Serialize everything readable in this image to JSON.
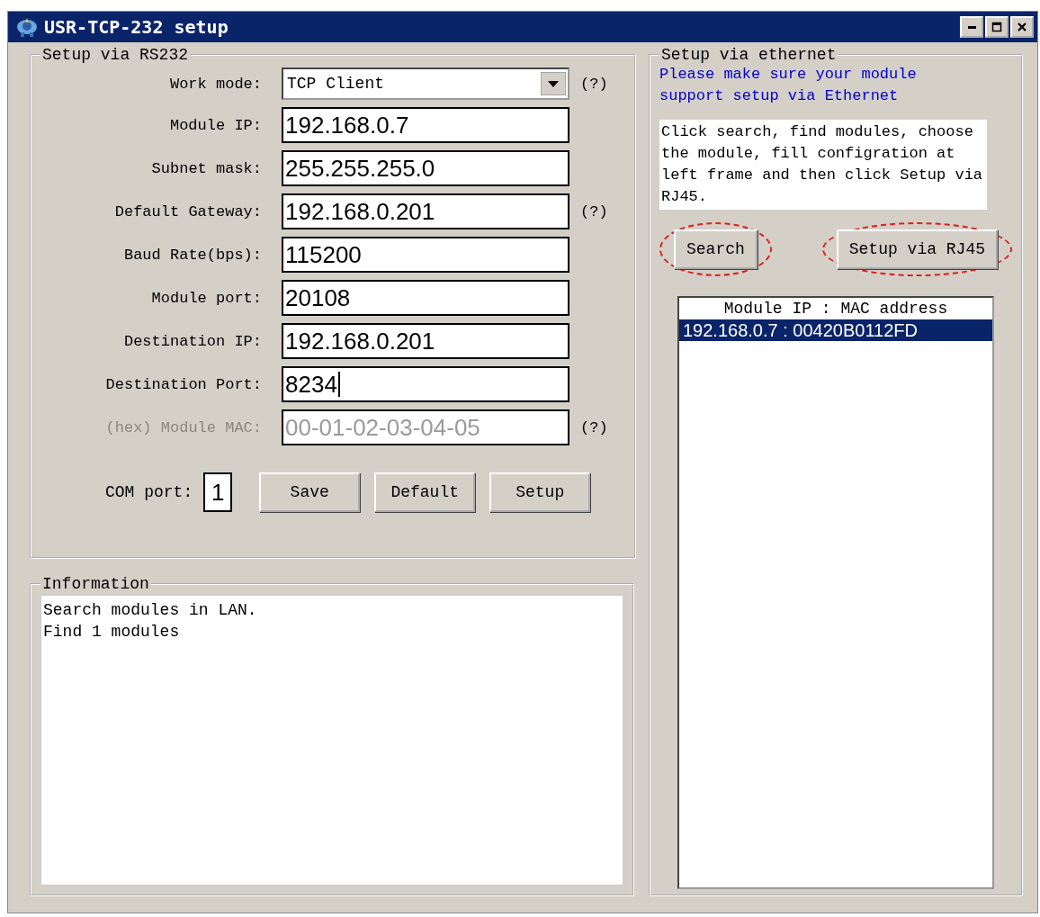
{
  "window": {
    "title": "USR-TCP-232 setup"
  },
  "rs232": {
    "title": "Setup via RS232",
    "fields": [
      {
        "label": "Work mode:",
        "value": "TCP Client",
        "kind": "dropdown",
        "disabled": false,
        "help": "(?)"
      },
      {
        "label": "Module IP:",
        "value": "192.168.0.7",
        "kind": "text",
        "disabled": false
      },
      {
        "label": "Subnet mask:",
        "value": "255.255.255.0",
        "kind": "text",
        "disabled": false
      },
      {
        "label": "Default Gateway:",
        "value": "192.168.0.201",
        "kind": "text",
        "disabled": false,
        "help": "(?)"
      },
      {
        "label": "Baud Rate(bps):",
        "value": "115200",
        "kind": "text",
        "disabled": false
      },
      {
        "label": "Module port:",
        "value": "20108",
        "kind": "text",
        "disabled": false
      },
      {
        "label": "Destination IP:",
        "value": "192.168.0.201",
        "kind": "text",
        "disabled": false
      },
      {
        "label": "Destination Port:",
        "value": "8234",
        "kind": "text",
        "disabled": false,
        "focused": true
      },
      {
        "label": "(hex) Module MAC:",
        "value": "00-01-02-03-04-05",
        "kind": "text",
        "disabled": true,
        "help": "(?)"
      }
    ],
    "com_port": {
      "label": "COM port:",
      "value": "1"
    },
    "buttons": [
      "Save",
      "Default",
      "Setup"
    ]
  },
  "information": {
    "title": "Information",
    "lines": [
      "Search modules in LAN.",
      "Find 1 modules"
    ]
  },
  "ethernet": {
    "title": "Setup via ethernet",
    "notice": "Please make sure your module support setup via Ethernet",
    "instructions": "Click search, find modules, choose the module, fill configration at left frame and then click Setup via RJ45.",
    "buttons": [
      {
        "label": "Search",
        "circled": true
      },
      {
        "label": "Setup via RJ45",
        "circled": true
      }
    ],
    "list": {
      "header": "Module IP : MAC address",
      "rows": [
        {
          "text": "192.168.0.7 : 00420B0112FD",
          "selected": true
        }
      ]
    }
  }
}
